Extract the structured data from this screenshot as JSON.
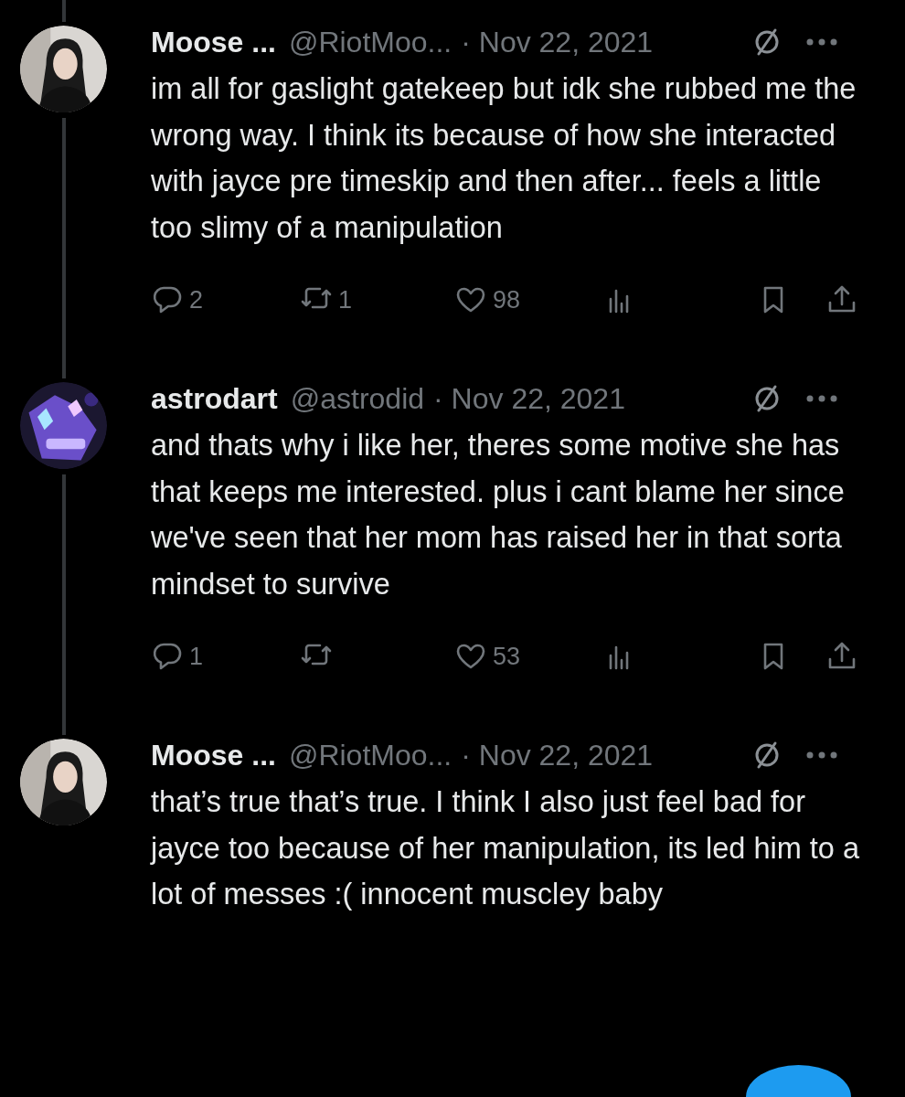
{
  "tweets": [
    {
      "display_name": "Moose ...",
      "handle": "@RiotMoo...",
      "date": "· Nov 22, 2021",
      "text": "im all for gaslight gatekeep but idk she rubbed me the wrong way. I think its because of how she interacted with jayce pre timeskip and then after... feels a little too slimy of a manipulation",
      "replies": "2",
      "reposts": "1",
      "likes": "98"
    },
    {
      "display_name": "astrodart",
      "handle": "@astrodid",
      "date": "· Nov 22, 2021",
      "text": "and thats why i like her, theres some motive she has that keeps me interested. plus i cant blame her since we've seen that her mom has raised her in that sorta mindset to survive",
      "replies": "1",
      "likes": "53"
    },
    {
      "display_name": "Moose ...",
      "handle": "@RiotMoo...",
      "date": "· Nov 22, 2021",
      "text": "that’s true that’s true. I think I also just feel bad for jayce too because of her manipulation, its led him to a lot of messes :( innocent muscley baby"
    }
  ]
}
